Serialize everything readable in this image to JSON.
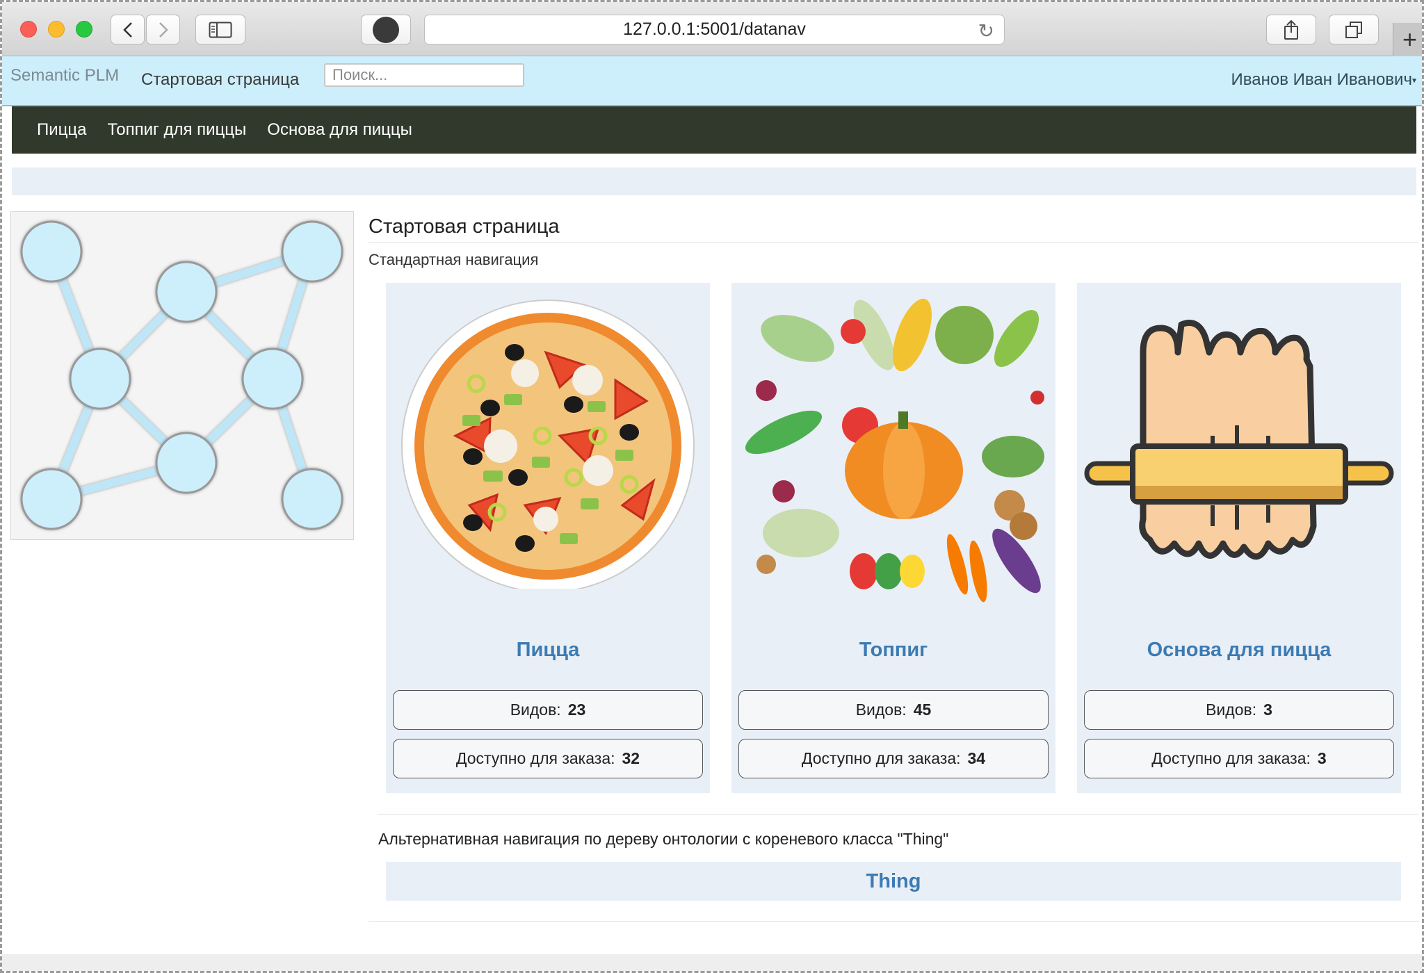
{
  "browser": {
    "url": "127.0.0.1:5001/datanav",
    "back_icon": "chevron-left-icon",
    "forward_icon": "chevron-right-icon",
    "sidebar_icon": "sidebar-icon",
    "share_icon": "share-icon",
    "tabs_icon": "tabs-icon",
    "new_tab_label": "+"
  },
  "topbar": {
    "brand": "Semantic PLM",
    "start_link": "Стартовая страница",
    "search_placeholder": "Поиск...",
    "user_name": "Иванов Иван Иванович"
  },
  "navbar": {
    "items": [
      "Пицца",
      "Топпиг для пиццы",
      "Основа для пиццы"
    ]
  },
  "main": {
    "title": "Стартовая страница",
    "subtitle": "Стандартная навигация",
    "cards": [
      {
        "name": "Пицца",
        "kinds_label": "Видов:",
        "kinds_value": "23",
        "available_label": "Доступно для заказа:",
        "available_value": "32",
        "image": "pizza"
      },
      {
        "name": "Топпиг",
        "kinds_label": "Видов:",
        "kinds_value": "45",
        "available_label": "Доступно для заказа:",
        "available_value": "34",
        "image": "vegetables"
      },
      {
        "name": "Основа для пицца",
        "kinds_label": "Видов:",
        "kinds_value": "3",
        "available_label": "Доступно для заказа:",
        "available_value": "3",
        "image": "dough-rolling-pin"
      }
    ],
    "alt_title": "Альтернативная навигация по дереву онтологии с кореневого класса \"Thing\"",
    "root_class": "Thing"
  },
  "colors": {
    "topbar_bg": "#cdeefb",
    "navbar_bg": "#31392c",
    "card_bg": "#e9eff6",
    "link_blue": "#3c7bb3",
    "node_fill": "#cdeefb"
  }
}
